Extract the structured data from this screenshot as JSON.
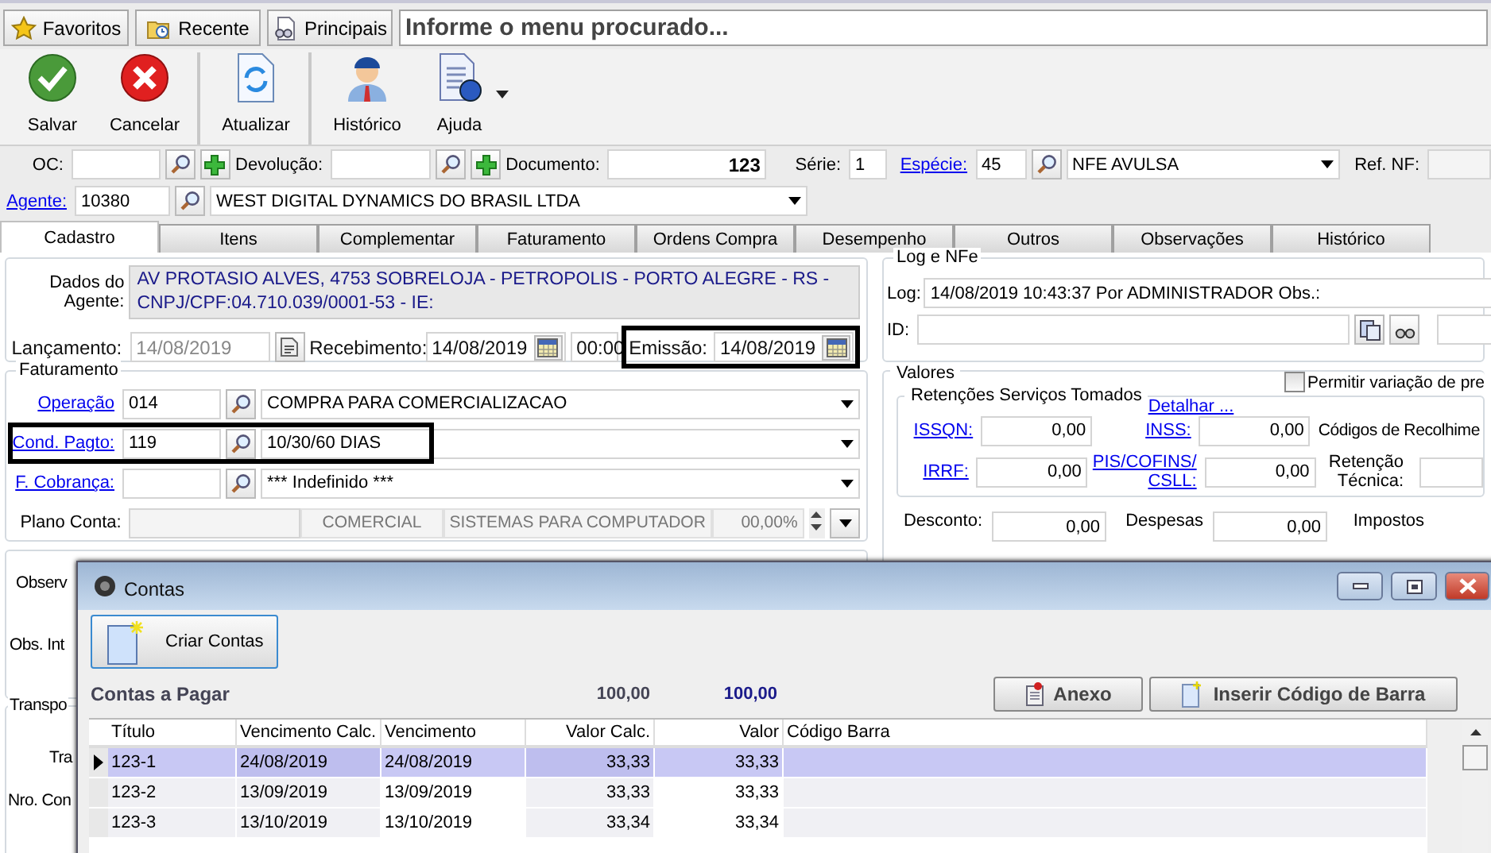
{
  "menu_bar": {
    "buttons": [
      {
        "label": "Favoritos",
        "kind": "favorites"
      },
      {
        "label": "Recente",
        "kind": "recent"
      },
      {
        "label": "Principais",
        "kind": "main"
      }
    ],
    "search": {
      "placeholder": "Informe o menu procurado..."
    }
  },
  "toolbar": [
    {
      "items": [
        {
          "label": "Salvar",
          "kind": "save",
          "dropdown": false
        },
        {
          "label": "Cancelar",
          "kind": "cancel",
          "dropdown": false
        }
      ]
    },
    {
      "items": [
        {
          "label": "Atualizar",
          "kind": "refresh",
          "dropdown": false
        }
      ]
    },
    {
      "items": [
        {
          "label": "Histórico",
          "kind": "history",
          "dropdown": false
        },
        {
          "label": "Ajuda",
          "kind": "help",
          "dropdown": true
        }
      ]
    }
  ],
  "header": {
    "oc_label": "OC:",
    "devolucao_label": "Devolução:",
    "documento_label": "Documento:",
    "documento": "123",
    "serie_label": "Série:",
    "serie": "1",
    "especie_label": "Espécie:",
    "especie_code": "45",
    "especie_name": "NFE AVULSA",
    "ref_nf_label": "Ref. NF:",
    "agente_label": "Agente:",
    "agente_code": "10380",
    "agente_name": "WEST DIGITAL DYNAMICS DO BRASIL LTDA"
  },
  "tabs": [
    {
      "label": "Cadastro",
      "selected": true
    },
    {
      "label": "Itens",
      "selected": false
    },
    {
      "label": "Complementar",
      "selected": false
    },
    {
      "label": "Faturamento",
      "selected": false
    },
    {
      "label": "Ordens Compra",
      "selected": false
    },
    {
      "label": "Desempenho",
      "selected": false
    },
    {
      "label": "Outros",
      "selected": false
    },
    {
      "label": "Observações",
      "selected": false
    },
    {
      "label": "Histórico",
      "selected": false
    }
  ],
  "cadastro": {
    "dados_label": "Dados do Agente:",
    "dados_value": "AV PROTASIO ALVES, 4753 SOBRELOJA - PETROPOLIS - PORTO ALEGRE - RS - CNPJ/CPF:04.710.039/0001-53 - IE:",
    "lancamento_label": "Lançamento:",
    "lancamento": "14/08/2019",
    "lancamento_disabled": true,
    "recebimento_label": "Recebimento:",
    "recebimento": "14/08/2019",
    "hora": "00:00",
    "emissao_label": "Emissão:",
    "emissao": "14/08/2019",
    "emissao_highlighted": true
  },
  "faturamento": {
    "title": "Faturamento",
    "rows": [
      {
        "label": "Operação",
        "code": "014",
        "description": "COMPRA PARA COMERCIALIZACAO",
        "highlighted": false
      },
      {
        "label": "Cond. Pagto:",
        "code": "119",
        "description": "10/30/60 DIAS",
        "highlighted": true
      },
      {
        "label": "F. Cobrança:",
        "description": "*** Indefinido ***",
        "highlighted": false
      }
    ],
    "plano_label": "Plano Conta:",
    "plano_cells": [
      "COMERCIAL",
      "SISTEMAS PARA COMPUTADOR",
      "00,00%"
    ]
  },
  "observacoes": {
    "labels": [
      "Observ",
      "Obs. Int"
    ]
  },
  "transporte": {
    "title": "Transpo",
    "labels": [
      "Tra",
      "Nro. Con"
    ]
  },
  "log": {
    "title": "Log e NFe",
    "log_label": "Log:",
    "log_value": "14/08/2019 10:43:37 Por ADMINISTRADOR Obs.:",
    "id_label": "ID:"
  },
  "valores": {
    "title": "Valores",
    "permitir": {
      "label": "Permitir variação de pre",
      "checked": false
    },
    "retencoes": {
      "title": "Retenções Serviços Tomados",
      "detail_link": "Detalhar ...",
      "fields": [
        {
          "label": "ISSQN:",
          "value": "0,00"
        },
        {
          "label": "INSS:",
          "value": "0,00"
        },
        {
          "label": "IRRF:",
          "value": "0,00"
        },
        {
          "label": "PIS/COFINS/ CSLL:",
          "value": "0,00"
        }
      ],
      "codigos_label": "Códigos de Recolhime",
      "retencao_label": "Retenção Técnica:"
    },
    "totals": [
      {
        "label": "Desconto:",
        "value": "0,00"
      },
      {
        "label": "Despesas",
        "value": "0,00"
      },
      {
        "label": "Impostos"
      }
    ]
  },
  "modal": {
    "title": "Contas",
    "create_button": "Criar Contas",
    "section_title": "Contas a Pagar",
    "total_calc": "100,00",
    "total": "100,00",
    "buttons": [
      {
        "label": "Anexo",
        "kind": "attach"
      },
      {
        "label": "Inserir Código de Barra",
        "kind": "new"
      }
    ],
    "table": {
      "columns": [
        "Título",
        "Vencimento Calc.",
        "Vencimento",
        "Valor Calc.",
        "Valor",
        "Código Barra"
      ],
      "rows": [
        {
          "cells": [
            "123-1",
            "24/08/2019",
            "24/08/2019",
            "33,33",
            "33,33"
          ],
          "selected": true
        },
        {
          "cells": [
            "123-2",
            "13/09/2019",
            "13/09/2019",
            "33,33",
            "33,33"
          ],
          "selected": false
        },
        {
          "cells": [
            "123-3",
            "13/10/2019",
            "13/10/2019",
            "33,34",
            "33,34"
          ],
          "selected": false
        }
      ]
    }
  }
}
